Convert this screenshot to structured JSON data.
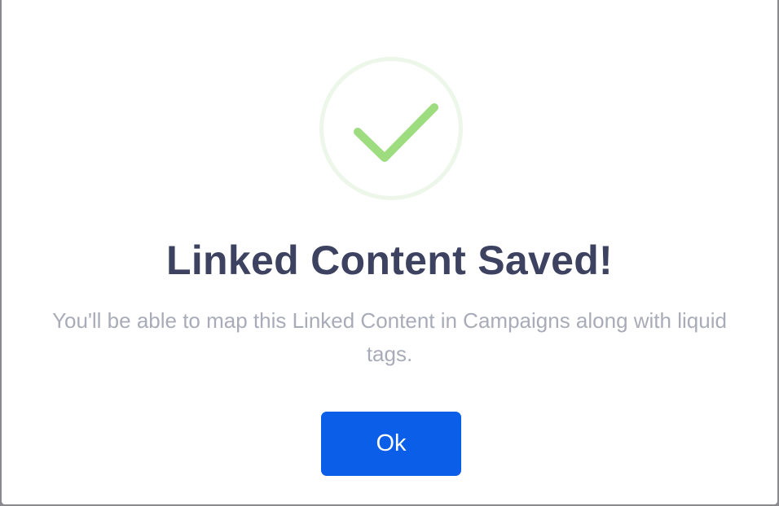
{
  "dialog": {
    "icon": "checkmark-icon",
    "title": "Linked Content Saved!",
    "message": "You'll be able to map this Linked Content in Campaigns along with liquid tags.",
    "ok_label": "Ok"
  },
  "colors": {
    "check": "#9ddc7f",
    "check_ring": "#ecf7e9",
    "title": "#3c4260",
    "message": "#a9acb8",
    "button": "#0b5ee8",
    "button_text": "#ffffff"
  }
}
